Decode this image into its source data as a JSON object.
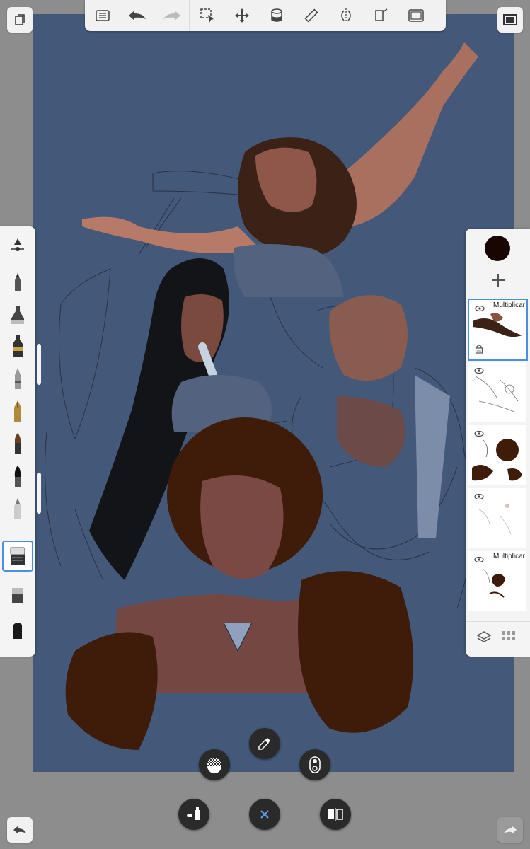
{
  "app": {
    "accent_color": "#4a90e2",
    "canvas_color": "#44597a",
    "current_color": "#1a0505"
  },
  "top_toolbar": {
    "items": [
      {
        "icon": "list-icon",
        "name": "layer-list-button"
      },
      {
        "icon": "undo-icon",
        "name": "undo-button"
      },
      {
        "icon": "redo-icon",
        "name": "redo-button"
      },
      {
        "icon": "selection-icon",
        "name": "select-button"
      },
      {
        "icon": "move-icon",
        "name": "transform-button"
      },
      {
        "icon": "fill-bucket-icon",
        "name": "fill-button"
      },
      {
        "icon": "ruler-icon",
        "name": "ruler-button"
      },
      {
        "icon": "symmetry-icon",
        "name": "symmetry-button"
      },
      {
        "icon": "perspective-icon",
        "name": "perspective-button"
      },
      {
        "icon": "frame-icon",
        "name": "frame-button"
      }
    ]
  },
  "brush_palette": {
    "brushes": [
      "settings",
      "pencil",
      "ink-pen",
      "marker",
      "airbrush",
      "fountain-pen",
      "paint-brush",
      "calligraphy-brush",
      "smudge",
      "eraser",
      "hard-eraser",
      "chisel-marker"
    ],
    "selected_index": 9
  },
  "layers": {
    "items": [
      {
        "blend_mode": "Multiplicar",
        "visible": true,
        "locked": true,
        "active": true
      },
      {
        "blend_mode": "",
        "visible": true,
        "locked": false,
        "active": false
      },
      {
        "blend_mode": "",
        "visible": true,
        "locked": false,
        "active": false
      },
      {
        "blend_mode": "",
        "visible": true,
        "locked": false,
        "active": false
      },
      {
        "blend_mode": "Multiplicar",
        "visible": true,
        "locked": false,
        "active": false
      }
    ]
  },
  "bottom_tools": {
    "items": [
      "transparency-icon",
      "eyedropper-icon",
      "opacity-toggle-icon",
      "fill-spray-icon",
      "close-icon",
      "flip-icon"
    ]
  }
}
